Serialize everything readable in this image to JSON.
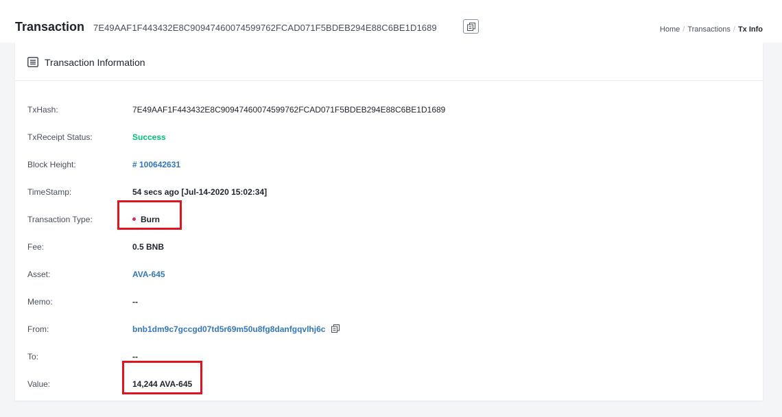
{
  "header": {
    "title": "Transaction",
    "tx_hash": "7E49AAF1F443432E8C90947460074599762FCAD071F5BDEB294E88C6BE1D1689",
    "copy_icon": "copy-icon"
  },
  "breadcrumb": {
    "home": "Home",
    "sep1": "/",
    "transactions": "Transactions",
    "sep2": "/",
    "current": "Tx Info"
  },
  "card": {
    "title": "Transaction Information",
    "icon": "list-icon"
  },
  "fields": {
    "txhash": {
      "label": "TxHash:",
      "value": "7E49AAF1F443432E8C90947460074599762FCAD071F5BDEB294E88C6BE1D1689"
    },
    "status": {
      "label": "TxReceipt Status:",
      "value": "Success"
    },
    "block": {
      "label": "Block Height:",
      "value": "# 100642631"
    },
    "timestamp": {
      "label": "TimeStamp:",
      "value": "54 secs ago [Jul-14-2020 15:02:34]"
    },
    "type": {
      "label": "Transaction Type:",
      "value": "Burn"
    },
    "fee": {
      "label": "Fee:",
      "value": "0.5 BNB"
    },
    "asset": {
      "label": "Asset:",
      "value": "AVA-645"
    },
    "memo": {
      "label": "Memo:",
      "value": "--"
    },
    "from": {
      "label": "From:",
      "value": "bnb1dm9c7gccgd07td5r69m50u8fg8danfgqvlhj6c"
    },
    "to": {
      "label": "To:",
      "value": "--"
    },
    "value": {
      "label": "Value:",
      "value": "14,244 AVA-645"
    }
  },
  "colors": {
    "link": "#3375bb",
    "success": "#02c076",
    "highlight": "#e0141e",
    "burn_dot": "#e0245e"
  }
}
